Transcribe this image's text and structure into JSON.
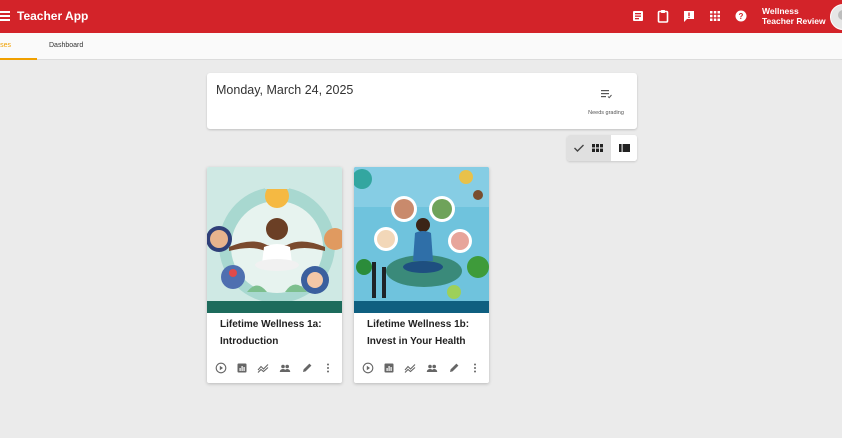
{
  "app": {
    "title": "Teacher App"
  },
  "user": {
    "line1": "Wellness",
    "line2": "Teacher Review"
  },
  "toolbar_icons": [
    "inbox-icon",
    "clipboard-icon",
    "feedback-icon",
    "apps-grid-icon",
    "help-icon"
  ],
  "tabs": [
    {
      "label": "ourses",
      "active": true
    },
    {
      "label": "Dashboard",
      "active": false
    }
  ],
  "date_card": {
    "date": "Monday, March 24, 2025",
    "needs_grading_label": "Needs grading"
  },
  "view_toggle": {
    "selected": "grid"
  },
  "courses": [
    {
      "line1": "Lifetime Wellness 1a:",
      "line2": "Introduction"
    },
    {
      "line1": "Lifetime Wellness 1b:",
      "line2": "Invest in Your Health"
    }
  ],
  "card_actions": [
    "play-icon",
    "gradebook-icon",
    "analytics-icon",
    "people-icon",
    "edit-icon",
    "more-vert-icon"
  ],
  "colors": {
    "brand": "#d32329",
    "tab_active": "#f0a000",
    "card_band": "#1d6b5c"
  }
}
